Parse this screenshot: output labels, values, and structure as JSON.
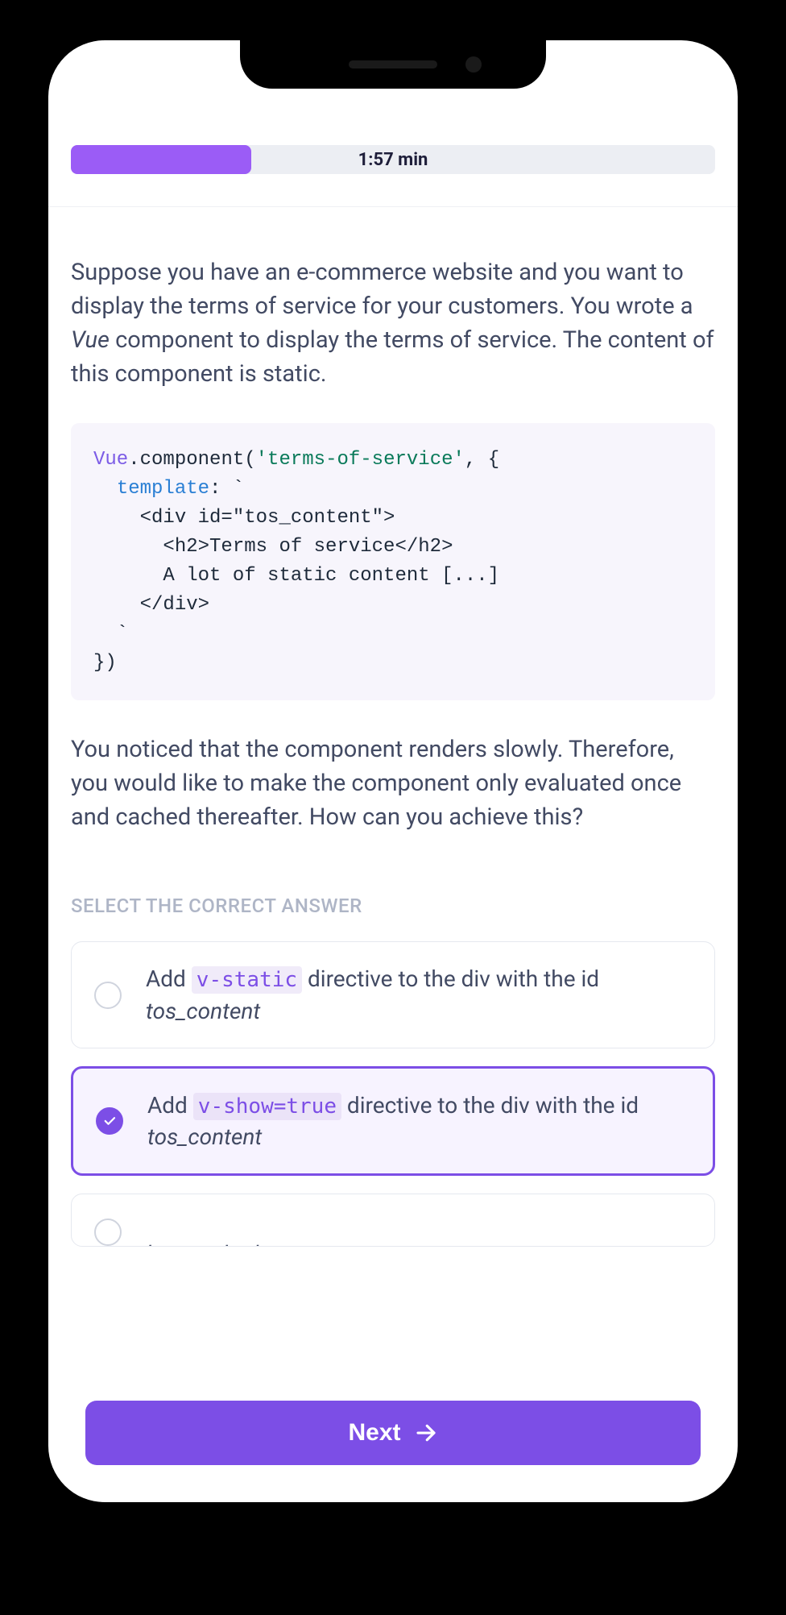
{
  "timer": "1:57 min",
  "progress_percent": 28,
  "question_intro": {
    "pre": "Suppose you have an e-commerce website and you want to display the terms of service for your customers. You wrote a ",
    "vue": "Vue",
    "post": " component to display the terms of service. The content of this component is static."
  },
  "code": {
    "class_name": "Vue",
    "method": ".component(",
    "arg_str": "'terms-of-service'",
    "after_arg": ", {",
    "template_key": "template",
    "template_colon": ": `",
    "line_div_open": "    <div id=\"tos_content\">",
    "line_h2": "      <h2>Terms of service</h2>",
    "line_static": "      A lot of static content [...]",
    "line_div_close": "    </div>",
    "line_backtick": "  `",
    "close": "})"
  },
  "question_followup": "You noticed that the component renders slowly. Therefore, you would like to make the component only evaluated once and cached thereafter. How can you achieve this?",
  "select_label": "SELECT THE CORRECT ANSWER",
  "options": [
    {
      "pre": "Add ",
      "code": "v-static",
      "mid": " directive to the div with the id ",
      "em": "tos_content",
      "selected": false
    },
    {
      "pre": "Add ",
      "code": "v-show=true",
      "mid": " directive to the div with the id ",
      "em": "tos_content",
      "selected": true
    }
  ],
  "option_partial_em": "tos_content",
  "next_label": "Next"
}
